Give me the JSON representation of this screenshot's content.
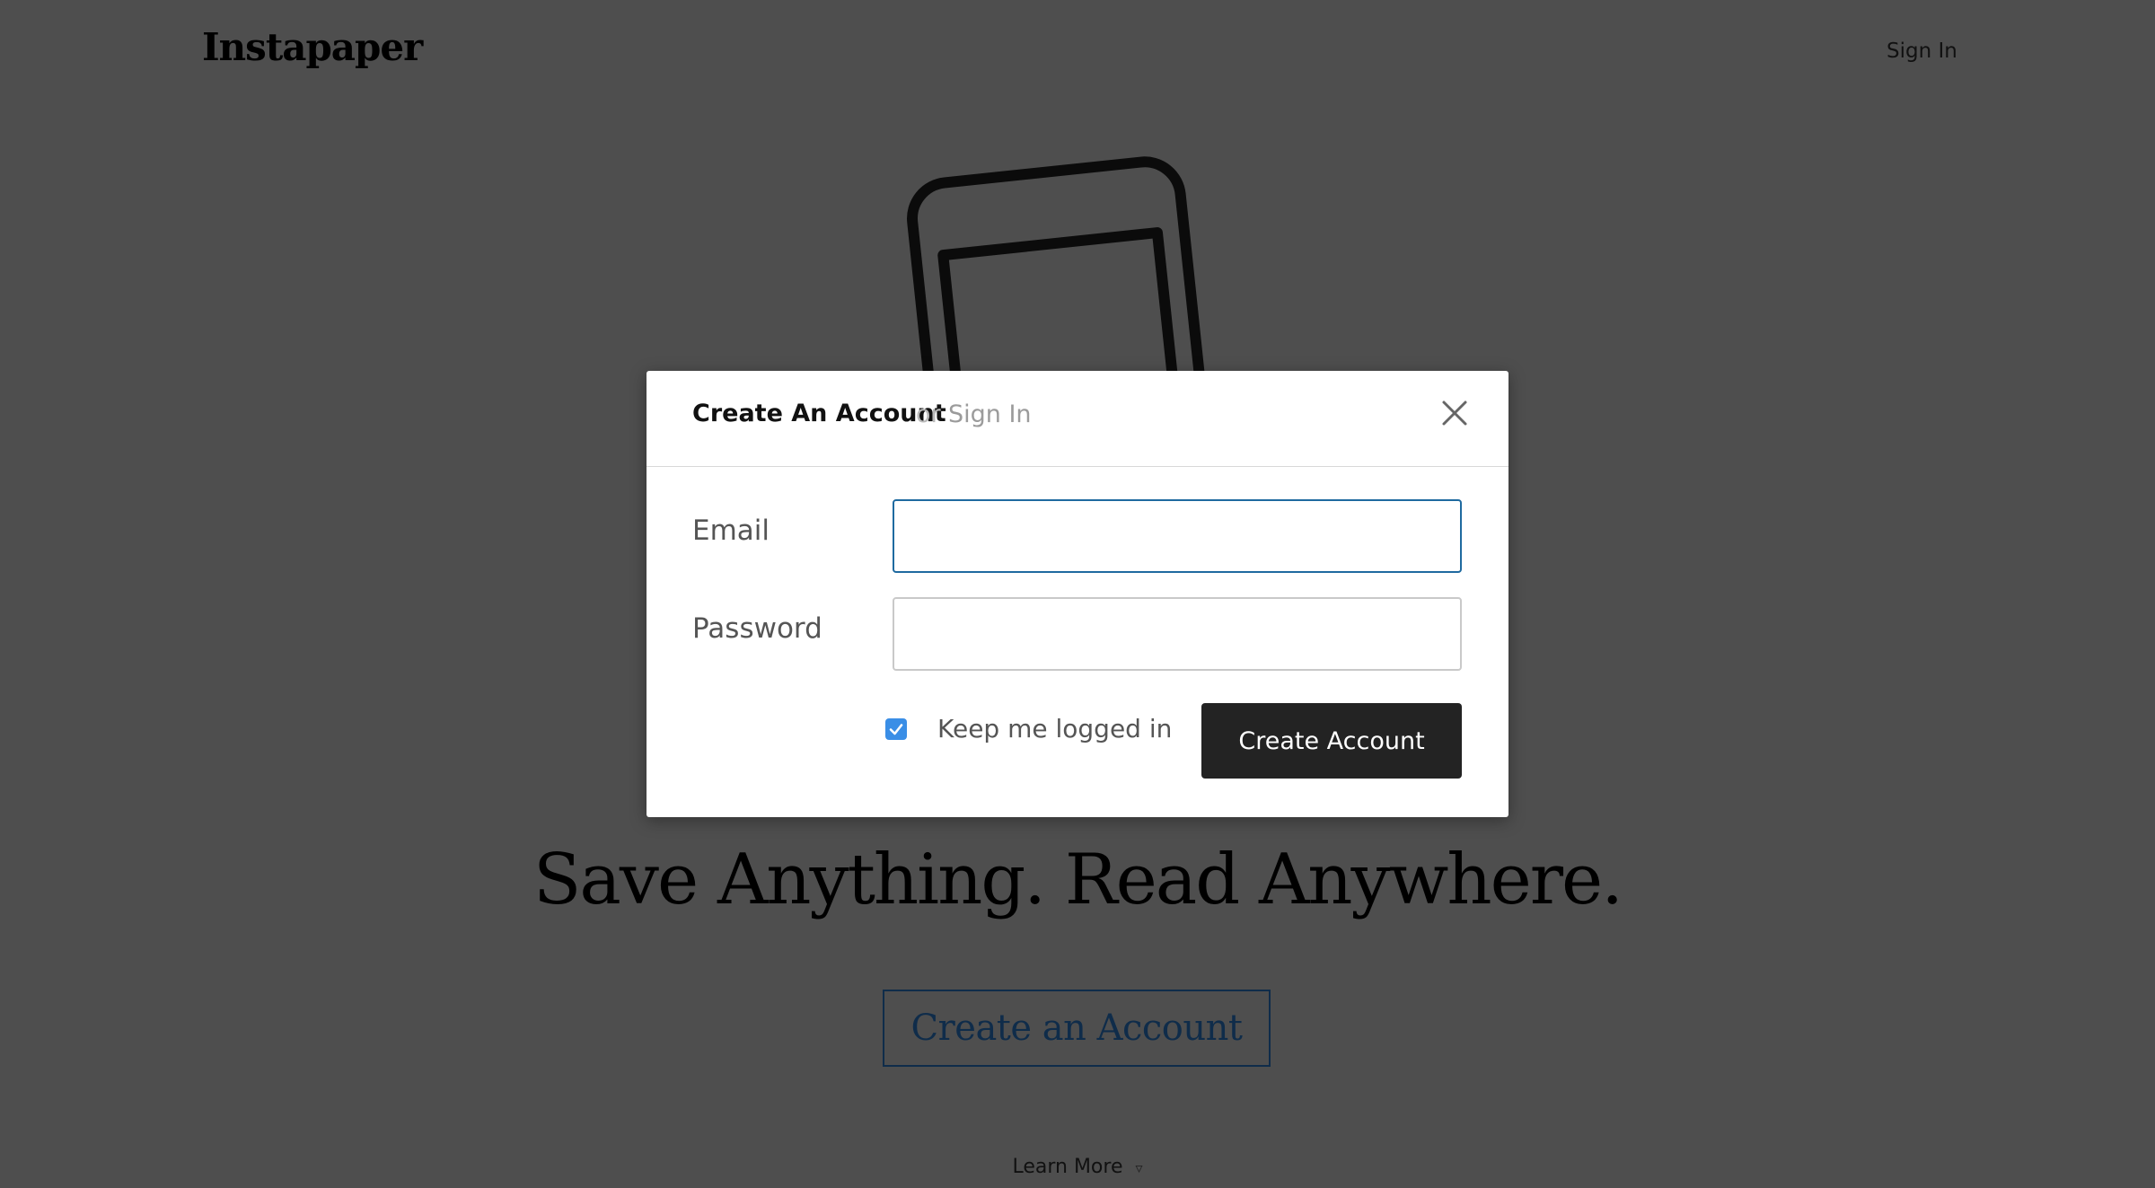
{
  "header": {
    "logo": "Instapaper",
    "sign_in": "Sign In"
  },
  "hero": {
    "headline": "Save Anything. Read Anywhere.",
    "cta": "Create an Account",
    "learn_more": "Learn More",
    "learn_more_icon": "triangle-down-icon"
  },
  "modal": {
    "title": "Create An Account",
    "or": "or",
    "switch_link": "Sign In",
    "close_icon": "close-icon",
    "email_label": "Email",
    "email_value": "",
    "password_label": "Password",
    "password_value": "",
    "keep_logged_in_label": "Keep me logged in",
    "keep_logged_in_checked": true,
    "submit": "Create Account"
  },
  "colors": {
    "backdrop": "#4e4e4e",
    "button_dark": "#232323",
    "focus_border": "#1f6aa0",
    "checkbox": "#3a8ee6",
    "hero_cta": "#0f2c4a"
  }
}
